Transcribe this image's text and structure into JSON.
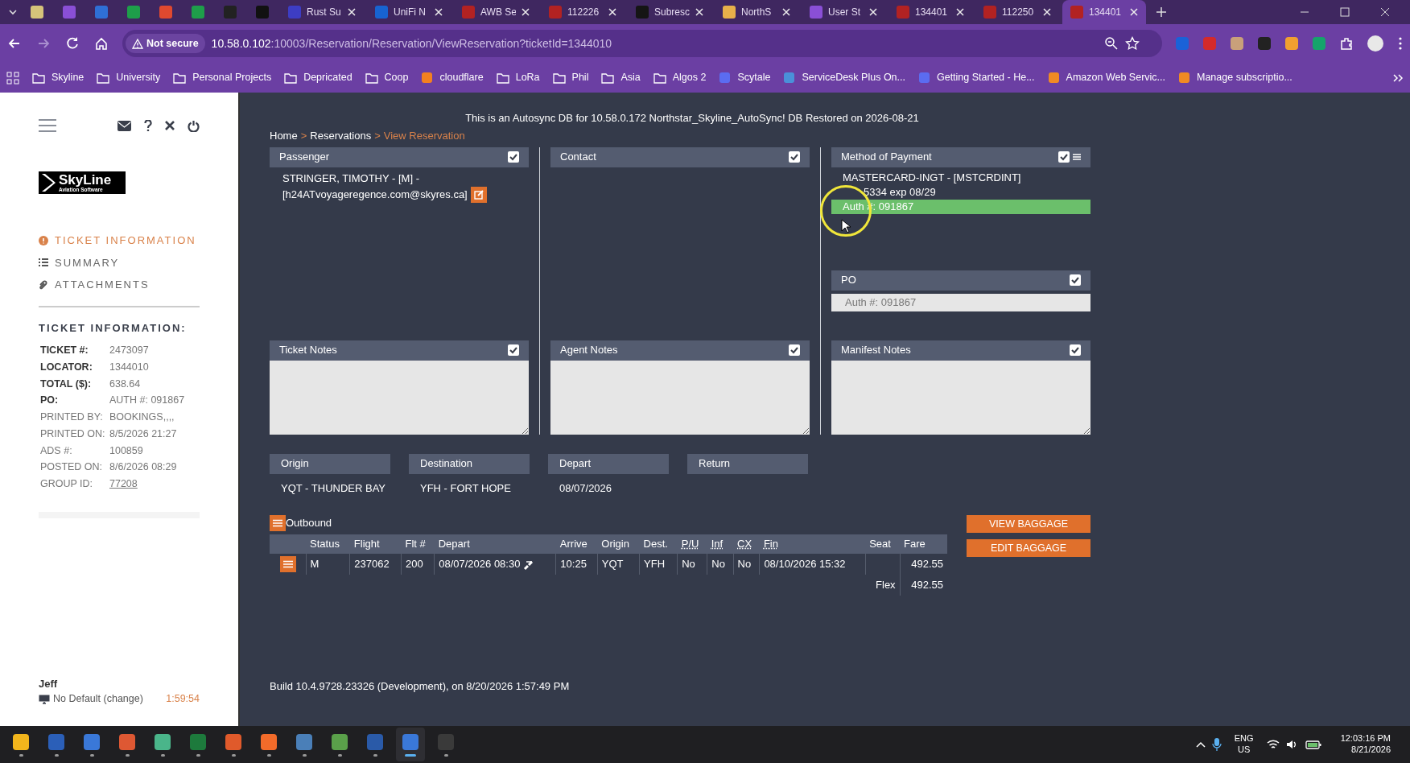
{
  "browser": {
    "tabs": [
      {
        "color": "#d6c37a",
        "selected": false
      },
      {
        "color": "#8a4fd6",
        "selected": false
      },
      {
        "color": "#2f6fd6",
        "selected": false
      },
      {
        "color": "#1e9e4a",
        "selected": false
      },
      {
        "color": "#e0492f",
        "selected": false
      },
      {
        "color": "#1e9e4a",
        "selected": false
      },
      {
        "color": "#222222",
        "selected": false
      },
      {
        "color": "#111111",
        "selected": false
      },
      {
        "title": "Rust Su",
        "color": "#3d3dc4",
        "selected": false
      },
      {
        "title": "UniFi N",
        "color": "#1763d1",
        "selected": false
      },
      {
        "title": "AWB Se",
        "color": "#b22222",
        "selected": false
      },
      {
        "title": "112226",
        "color": "#b22222",
        "selected": false
      },
      {
        "title": "Subresc",
        "color": "#151515",
        "selected": false
      },
      {
        "title": "NorthS",
        "color": "#e8b04a",
        "selected": false
      },
      {
        "title": "User St",
        "color": "#8a4fd6",
        "selected": false
      },
      {
        "title": "134401",
        "color": "#b22222",
        "selected": false
      },
      {
        "title": "112250",
        "color": "#b22222",
        "selected": false
      },
      {
        "title": "134401",
        "color": "#b22222",
        "selected": true
      }
    ],
    "security": "Not secure",
    "url_host": "10.58.0.102",
    "url_path": ":10003/Reservation/Reservation/ViewReservation?ticketId=1344010",
    "bookmarks": [
      {
        "label": "Skyline",
        "kind": "folder"
      },
      {
        "label": "University",
        "kind": "folder"
      },
      {
        "label": "Personal Projects",
        "kind": "folder"
      },
      {
        "label": "Depricated",
        "kind": "folder"
      },
      {
        "label": "Coop",
        "kind": "folder"
      },
      {
        "label": "cloudflare",
        "kind": "site",
        "color": "#f38020"
      },
      {
        "label": "LoRa",
        "kind": "folder"
      },
      {
        "label": "Phil",
        "kind": "folder"
      },
      {
        "label": "Asia",
        "kind": "folder"
      },
      {
        "label": "Algos 2",
        "kind": "folder"
      },
      {
        "label": "Scytale",
        "kind": "site",
        "color": "#5b6cf0"
      },
      {
        "label": "ServiceDesk Plus On...",
        "kind": "site",
        "color": "#4a90d9"
      },
      {
        "label": "Getting Started - He...",
        "kind": "site",
        "color": "#5b6cf0"
      },
      {
        "label": "Amazon Web Servic...",
        "kind": "site",
        "color": "#f08a24"
      },
      {
        "label": "Manage subscriptio...",
        "kind": "site",
        "color": "#f08a24"
      }
    ]
  },
  "sidebar": {
    "logo_main": "SkyLine",
    "logo_sub": "Aviation Software",
    "nav": [
      {
        "label": "TICKET INFORMATION",
        "kind": "info",
        "selected": true
      },
      {
        "label": "SUMMARY",
        "kind": "list",
        "selected": false
      },
      {
        "label": "ATTACHMENTS",
        "kind": "clip",
        "selected": false
      }
    ],
    "info_title": "TICKET INFORMATION:",
    "info": [
      {
        "label": "TICKET #:",
        "value": "2473097",
        "kind": "bold"
      },
      {
        "label": "LOCATOR:",
        "value": "1344010",
        "kind": "bold"
      },
      {
        "label": "TOTAL ($):",
        "value": "638.64",
        "kind": "bold"
      },
      {
        "label": "PO:",
        "value": "AUTH #: 091867",
        "kind": "bold"
      },
      {
        "label": "PRINTED BY:",
        "value": "BOOKINGS,,,,",
        "kind": "plain"
      },
      {
        "label": "PRINTED ON:",
        "value": "8/5/2026 21:27",
        "kind": "plain"
      },
      {
        "label": "ADS #:",
        "value": "100859",
        "kind": "plain"
      },
      {
        "label": "POSTED ON:",
        "value": "8/6/2026 08:29",
        "kind": "plain"
      },
      {
        "label": "GROUP ID:",
        "value": "77208",
        "kind": "link"
      }
    ],
    "user": "Jeff",
    "printer": "No Default (change)",
    "timer": "1:59:54"
  },
  "banner": "This is an Autosync DB for 10.58.0.172 Northstar_Skyline_AutoSync! DB Restored on 2026-08-21",
  "breadcrumb": [
    {
      "label": "Home",
      "selected": false
    },
    {
      "label": "Reservations",
      "selected": false
    },
    {
      "label": "View Reservation",
      "selected": true
    }
  ],
  "breadcrumb_separator": ">",
  "panels": [
    {
      "title": "Passenger",
      "checked": true,
      "kind": "text",
      "text": "STRINGER, TIMOTHY - [M] - [h24ATvoyageregence.com@skyres.ca]"
    },
    {
      "title": "Contact",
      "checked": true,
      "kind": "text"
    },
    {
      "title": "Method of Payment",
      "checked": true,
      "kind": "payment",
      "lines": [
        {
          "text": "MASTERCARD-INGT - [MSTCRDINT]",
          "selected": false
        },
        {
          "text": "5334 exp 08/29",
          "selected": false
        },
        {
          "text": "Auth #: 091867",
          "selected": true
        }
      ]
    },
    {
      "title": "PO",
      "checked": true,
      "kind": "field",
      "value": "Auth #: 091867"
    },
    {
      "title": "Ticket Notes",
      "checked": true,
      "kind": "notes"
    },
    {
      "title": "Agent Notes",
      "checked": true,
      "kind": "notes"
    },
    {
      "title": "Manifest Notes",
      "checked": true,
      "kind": "notes"
    }
  ],
  "trip": [
    {
      "label": "Origin",
      "value": "YQT - THUNDER BAY"
    },
    {
      "label": "Destination",
      "value": "YFH - FORT HOPE"
    },
    {
      "label": "Depart",
      "value": "08/07/2026"
    },
    {
      "label": "Return"
    }
  ],
  "segment_title": "Outbound",
  "table": {
    "columns": [
      {
        "label": "Status",
        "abbr": false
      },
      {
        "label": "Flight",
        "abbr": false
      },
      {
        "label": "Flt #",
        "abbr": false
      },
      {
        "label": "Depart",
        "abbr": false
      },
      {
        "label": "Arrive",
        "abbr": false
      },
      {
        "label": "Origin",
        "abbr": false
      },
      {
        "label": "Dest.",
        "abbr": false
      },
      {
        "label": "P/U",
        "abbr": true
      },
      {
        "label": "Inf",
        "abbr": true
      },
      {
        "label": "CX",
        "abbr": true
      },
      {
        "label": "Fin",
        "abbr": true
      },
      {
        "label": "Seat",
        "abbr": false
      },
      {
        "label": "Fare",
        "abbr": false
      }
    ],
    "rows": [
      {
        "cells": [
          "M",
          "237062",
          "200",
          "08/07/2026 08:30",
          "10:25",
          "YQT",
          "YFH",
          "No",
          "No",
          "No",
          "08/10/2026 15:32",
          "",
          "492.55"
        ]
      }
    ],
    "fare_label": "Flex",
    "fare_total": "492.55"
  },
  "buttons": [
    "VIEW BAGGAGE",
    "EDIT BAGGAGE"
  ],
  "build": "Build 10.4.9728.23326 (Development), on 8/20/2026 1:57:49 PM",
  "taskbar": {
    "apps": [
      {
        "color": "#f2b51c",
        "selected": false
      },
      {
        "color": "#2b5fb8",
        "selected": false
      },
      {
        "color": "#3a78d8",
        "selected": false
      },
      {
        "color": "#de5833",
        "selected": false
      },
      {
        "color": "#4ab58a",
        "selected": false
      },
      {
        "color": "#1d7a3c",
        "selected": false
      },
      {
        "color": "#e05a2b",
        "selected": false
      },
      {
        "color": "#f26b2a",
        "selected": false
      },
      {
        "color": "#4a7fb8",
        "selected": false
      },
      {
        "color": "#5aa04a",
        "selected": false
      },
      {
        "color": "#2a5aa8",
        "selected": false
      },
      {
        "color": "#3a78d8",
        "selected": true
      },
      {
        "color": "#3a3a3a",
        "selected": false
      }
    ],
    "language": "ENG",
    "region": "US",
    "time": "12:03:16 PM",
    "date": "8/21/2026"
  }
}
